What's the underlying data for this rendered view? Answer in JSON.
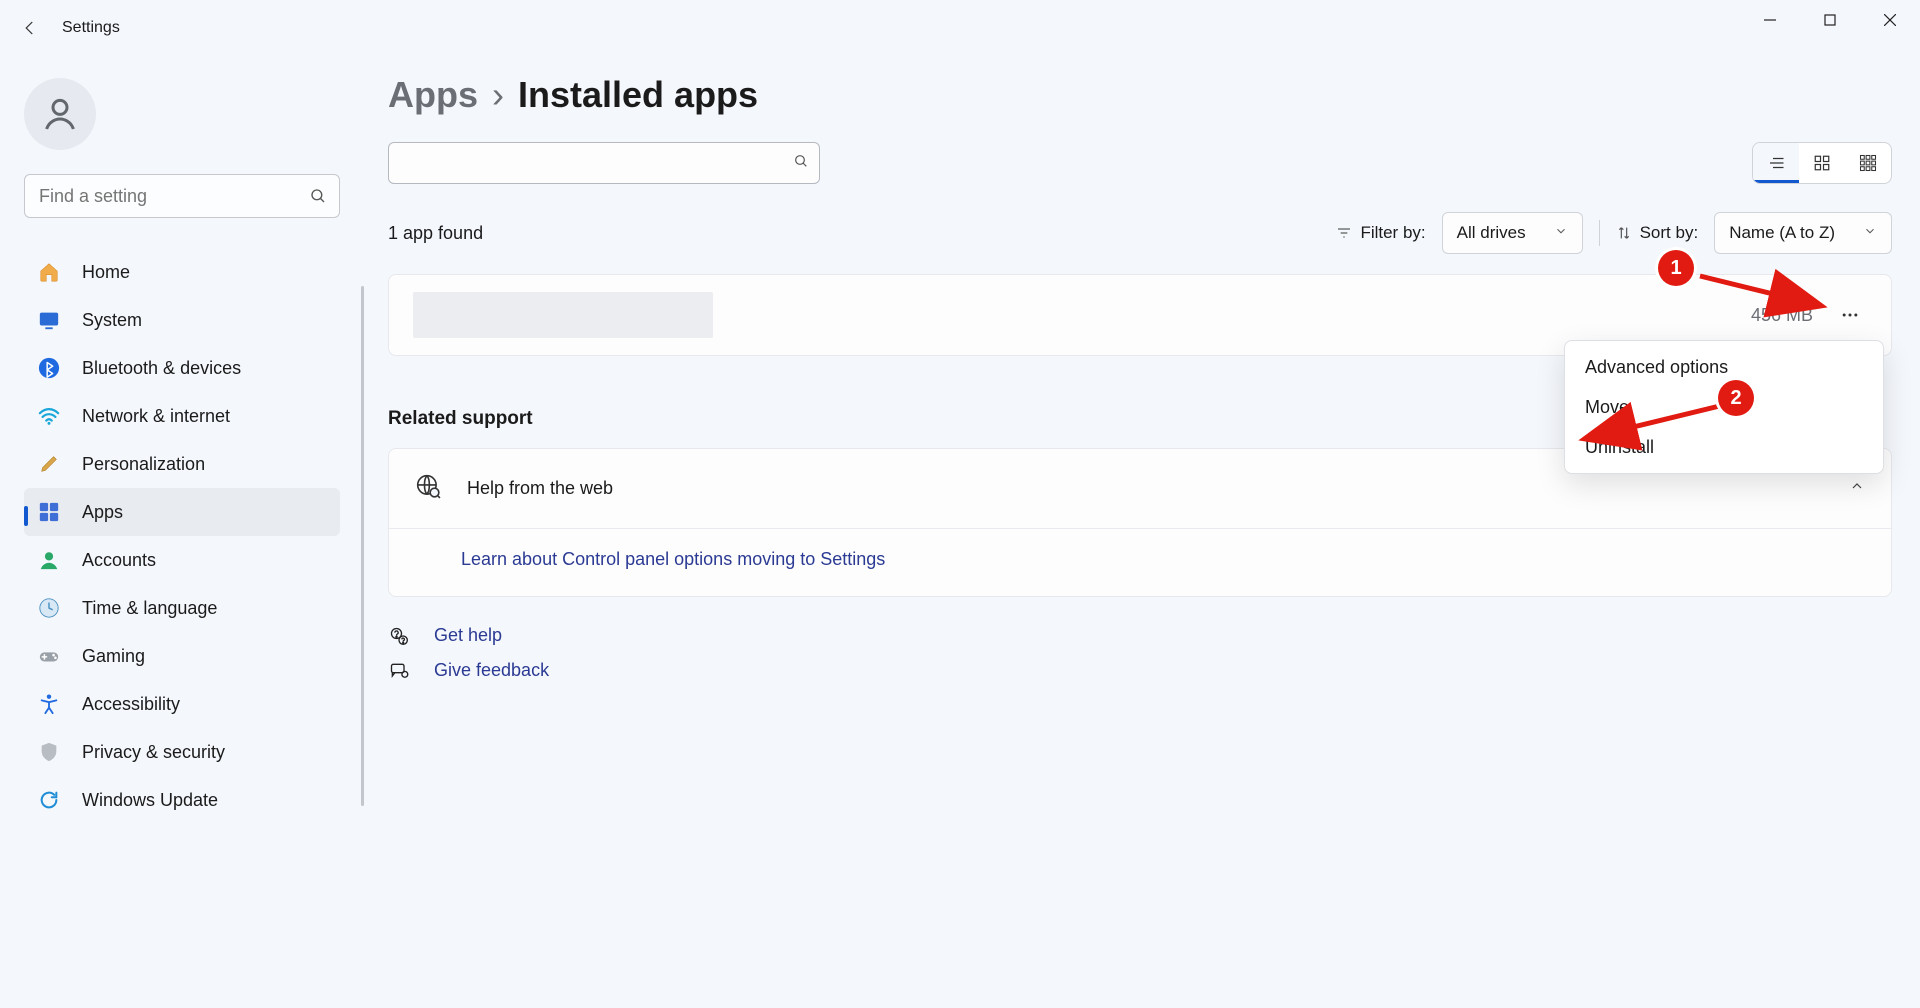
{
  "titlebar": {
    "title": "Settings"
  },
  "sidebar": {
    "search_placeholder": "Find a setting",
    "items": [
      {
        "id": "home",
        "label": "Home"
      },
      {
        "id": "system",
        "label": "System"
      },
      {
        "id": "bluetooth",
        "label": "Bluetooth & devices"
      },
      {
        "id": "network",
        "label": "Network & internet"
      },
      {
        "id": "personalization",
        "label": "Personalization"
      },
      {
        "id": "apps",
        "label": "Apps"
      },
      {
        "id": "accounts",
        "label": "Accounts"
      },
      {
        "id": "time",
        "label": "Time & language"
      },
      {
        "id": "gaming",
        "label": "Gaming"
      },
      {
        "id": "accessibility",
        "label": "Accessibility"
      },
      {
        "id": "privacy",
        "label": "Privacy & security"
      },
      {
        "id": "update",
        "label": "Windows Update"
      }
    ],
    "active_id": "apps"
  },
  "breadcrumb": {
    "root": "Apps",
    "page": "Installed apps"
  },
  "filters": {
    "count_text": "1 app found",
    "filter_label": "Filter by:",
    "filter_value": "All drives",
    "sort_label": "Sort by:",
    "sort_value": "Name (A to Z)"
  },
  "app_row": {
    "size": "456 MB"
  },
  "context_menu": {
    "items": [
      {
        "id": "advanced",
        "label": "Advanced options"
      },
      {
        "id": "move",
        "label": "Move"
      },
      {
        "id": "uninstall",
        "label": "Uninstall"
      }
    ]
  },
  "support": {
    "heading": "Related support",
    "help_title": "Help from the web",
    "link": "Learn about Control panel options moving to Settings"
  },
  "footer": {
    "get_help": "Get help",
    "give_feedback": "Give feedback"
  },
  "annotations": {
    "badge1": "1",
    "badge2": "2"
  }
}
